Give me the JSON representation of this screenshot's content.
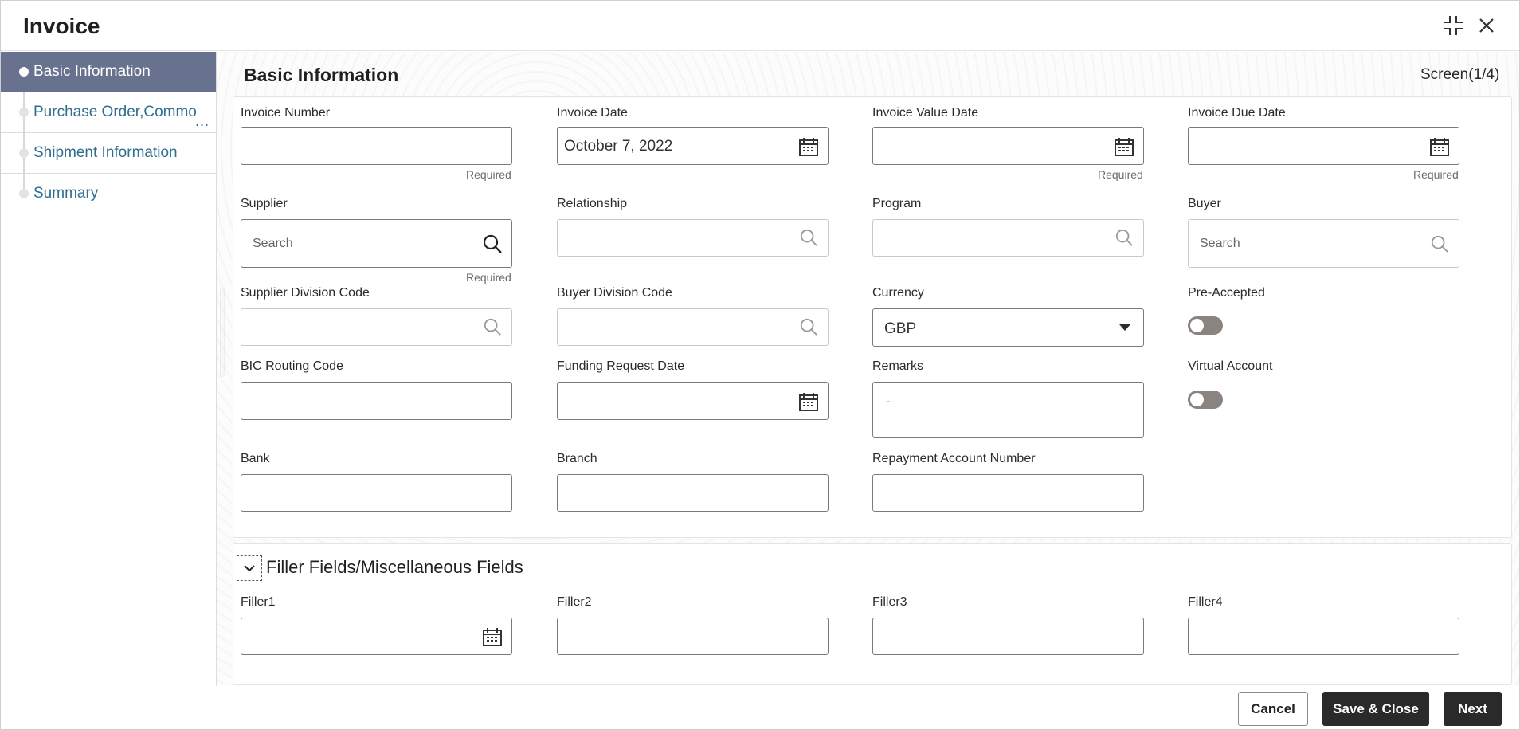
{
  "window": {
    "title": "Invoice",
    "minimize_icon": "collapse-arrows-icon",
    "close_icon": "close-icon"
  },
  "sidebar": {
    "items": [
      {
        "label": "Basic Information",
        "active": true
      },
      {
        "label": "Purchase Order,Commo",
        "more": "..."
      },
      {
        "label": "Shipment Information"
      },
      {
        "label": "Summary"
      }
    ]
  },
  "main": {
    "title": "Basic Information",
    "screen_indicator": "Screen(1/4)"
  },
  "form": {
    "invoice_number": {
      "label": "Invoice Number",
      "value": "",
      "hint": "Required"
    },
    "invoice_date": {
      "label": "Invoice Date",
      "value": "October 7, 2022"
    },
    "invoice_value_date": {
      "label": "Invoice Value Date",
      "value": "",
      "hint": "Required"
    },
    "invoice_due_date": {
      "label": "Invoice Due Date",
      "value": "",
      "hint": "Required"
    },
    "supplier": {
      "label": "Supplier",
      "placeholder": "Search",
      "hint": "Required"
    },
    "relationship": {
      "label": "Relationship",
      "value": ""
    },
    "program": {
      "label": "Program",
      "value": ""
    },
    "buyer": {
      "label": "Buyer",
      "placeholder": "Search"
    },
    "supplier_division_code": {
      "label": "Supplier Division Code",
      "value": ""
    },
    "buyer_division_code": {
      "label": "Buyer Division Code",
      "value": ""
    },
    "currency": {
      "label": "Currency",
      "value": "GBP"
    },
    "pre_accepted": {
      "label": "Pre-Accepted",
      "on": false
    },
    "bic_routing_code": {
      "label": "BIC Routing Code",
      "value": ""
    },
    "funding_request_date": {
      "label": "Funding Request Date",
      "value": ""
    },
    "remarks": {
      "label": "Remarks",
      "value": "-"
    },
    "virtual_account": {
      "label": "Virtual Account",
      "on": false
    },
    "bank": {
      "label": "Bank",
      "value": ""
    },
    "branch": {
      "label": "Branch",
      "value": ""
    },
    "repayment_account_number": {
      "label": "Repayment Account Number",
      "value": ""
    }
  },
  "filler_section": {
    "title": "Filler Fields/Miscellaneous Fields",
    "expanded": true,
    "filler1": {
      "label": "Filler1"
    },
    "filler2": {
      "label": "Filler2"
    },
    "filler3": {
      "label": "Filler3"
    },
    "filler4": {
      "label": "Filler4"
    }
  },
  "footer": {
    "cancel": "Cancel",
    "save_close": "Save & Close",
    "next": "Next"
  },
  "colors": {
    "sidebar_active": "#68728f",
    "nav_link": "#2e6e8e",
    "primary_button": "#2a2a2a",
    "toggle_off": "#8a8380"
  }
}
